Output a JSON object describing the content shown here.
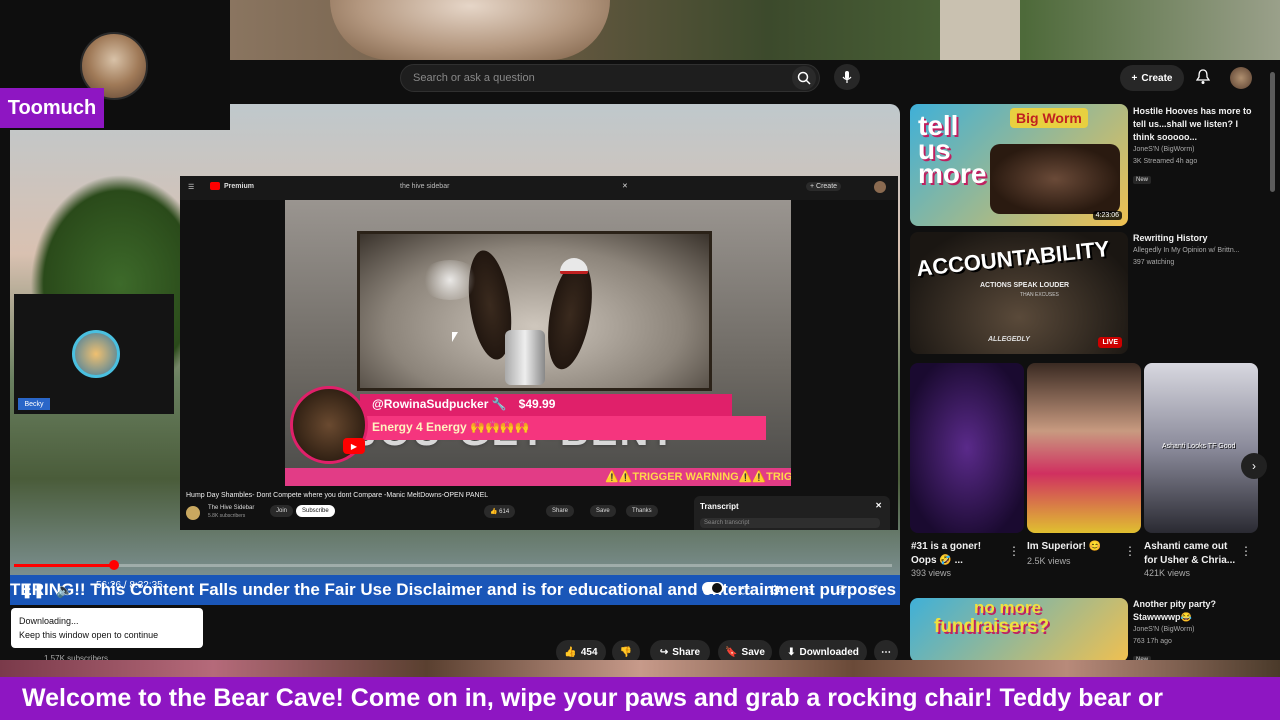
{
  "overlay": {
    "streamer_tag": "Toomuch",
    "cohost_tag": "Becky",
    "bottom_ticker": "Welcome to the Bear Cave! Come on in, wipe your paws and grab a rocking chair! Teddy bear or",
    "purple": "#8e16c2"
  },
  "topbar": {
    "search_placeholder": "Search or ask a question",
    "create_label": "Create",
    "icons": [
      "search-icon",
      "mic-icon",
      "plus-icon",
      "bell-icon"
    ]
  },
  "inner_page": {
    "logo": "Premium",
    "search_text": "the hive sidebar",
    "create_label": "+ Create",
    "title": "Hump Day Shambles- Dont Compete where you dont Compare -Manic MeltDowns-OPEN PANEL",
    "channel": "The Hive Sidebar",
    "channel_subs": "5.8K subscribers",
    "join_label": "Join",
    "subscribe_label": "Subscribe",
    "likes": "614",
    "share_label": "Share",
    "save_label": "Save",
    "thanks_label": "Thanks",
    "transcript_label": "Transcript",
    "transcript_search": "Search transcript",
    "banner_word": "JOU-GET-BENT",
    "trigger_text": "⚠️⚠️TRIGGER WARNING⚠️⚠️TRIGGER"
  },
  "superchat": {
    "user": "@RowinaSudpucker 🔧",
    "amount": "$49.99",
    "message": "Energy 4 Energy 🙌🙌🙌🙌",
    "color": "#e0206a"
  },
  "player": {
    "time": "56:26 / 8:32:35",
    "ticker": "TERING!! This Content Falls under the Fair Use Disclaimer and is for educational and entertainment purposes",
    "progress_fraction": 0.114
  },
  "toast": {
    "line1": "Downloading...",
    "line2": "Keep this window open to continue"
  },
  "channel_row": {
    "subs": "1.57K subscribers"
  },
  "actions": {
    "likes": "454",
    "share": "Share",
    "save": "Save",
    "downloaded": "Downloaded"
  },
  "sidebar": {
    "videos": [
      {
        "title_line1": "Hostile Hooves has more to",
        "title_line2": "tell us...shall we listen? I",
        "title_line3": "think sooooo...",
        "channel": "JoneS'N (BigWorm)",
        "meta": "3K  Streamed 4h ago",
        "badge": "New",
        "duration": "4:23:06",
        "thumb_text1": "tell",
        "thumb_text2": "us",
        "thumb_text3": "more",
        "thumb_sign": "Big Worm"
      },
      {
        "title_line1": "Rewriting History",
        "channel": "Allegedly In My Opinion w/ Brittn...",
        "meta": "397 watching",
        "live": "LIVE",
        "thumb_text1": "ACCOUNTABILITY",
        "thumb_text2": "ACTIONS SPEAK LOUDER",
        "thumb_text3": "THAN EXCUSES",
        "thumb_text4": "ALLEGEDLY"
      },
      {
        "title_line1": "Another pity party?",
        "title_line2": "Stawwwwp😂",
        "channel": "JoneS'N (BigWorm)",
        "meta": "763  17h ago",
        "badge": "New",
        "thumb_text1": "no more",
        "thumb_text2": "fundraisers?"
      }
    ],
    "shorts": [
      {
        "title_line1": "#31 is a goner!",
        "title_line2": "Oops 🤣 ...",
        "views": "393 views"
      },
      {
        "title_line1": "Im Superior! 😊",
        "views": "2.5K views"
      },
      {
        "title_line1": "Ashanti came out",
        "title_line2": "for Usher & Chria...",
        "views": "421K views",
        "caption": "Ashanti Looks TF Good"
      }
    ]
  }
}
